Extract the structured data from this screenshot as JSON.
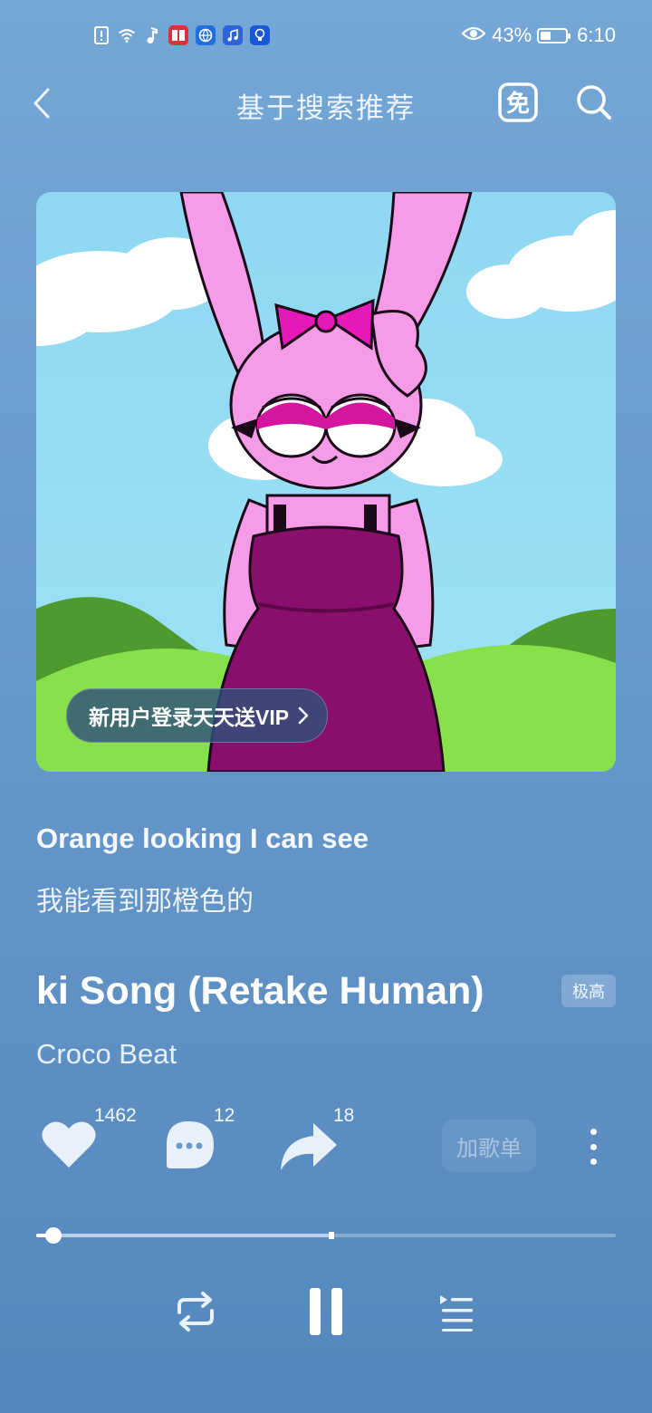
{
  "status_bar": {
    "battery": "43%",
    "battery_fraction": 0.43,
    "time": "6:10",
    "left_icons": [
      "sim-alert-icon",
      "wifi-icon",
      "music-note-icon",
      "app-red-icon",
      "app-browser-icon",
      "app-music-icon",
      "app-bulb-icon"
    ],
    "right_icons": [
      "eye-icon",
      "battery-icon"
    ]
  },
  "header": {
    "title": "基于搜索推荐",
    "free_label": "免",
    "icons": [
      "back-arrow-icon",
      "free-mode-icon",
      "search-icon"
    ]
  },
  "cover": {
    "promo_text": "新用户登录天天送VIP",
    "promo_icon": "chevron-right-icon"
  },
  "lyrics": {
    "current_line": "Orange looking I can see",
    "current_translation": "我能看到那橙色的"
  },
  "song": {
    "title": "ki Song (Retake Human)",
    "quality": "极高",
    "artist": "Croco Beat"
  },
  "actions": {
    "like_count": "1462",
    "comment_count": "12",
    "share_count": "18",
    "add_to_playlist": "加歌单",
    "icons": [
      "heart-icon",
      "comment-icon",
      "share-icon",
      "more-vertical-icon"
    ]
  },
  "progress": {
    "played_fraction": 0.03,
    "buffered_fraction": 0.51
  },
  "controls": {
    "icons": [
      "repeat-icon",
      "pause-icon",
      "playlist-icon"
    ]
  },
  "colors": {
    "background_top": "#74a6d6",
    "background_bottom": "#5487bd",
    "cover_sky": "#8fd8f2",
    "character_pink": "#f59be8",
    "dress_purple": "#8a0f6c",
    "grass": "#88e04a"
  }
}
